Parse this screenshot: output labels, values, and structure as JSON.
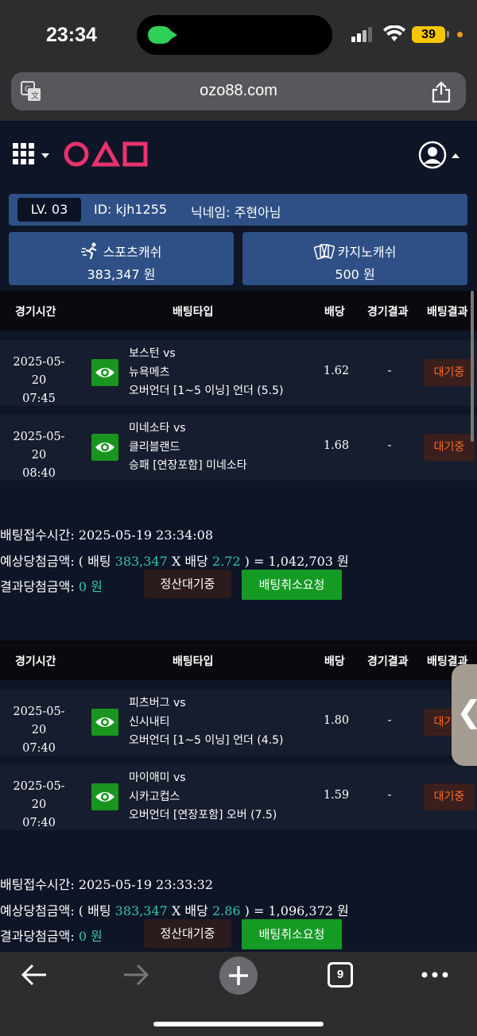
{
  "status_bar": {
    "time": "23:34",
    "battery": "39"
  },
  "browser": {
    "url": "ozo88.com",
    "tab_count": "9"
  },
  "header": {
    "logo": "OΔ□"
  },
  "account": {
    "level": "LV. 03",
    "id": "ID: kjh1255",
    "nickname": "닉네임: 주현아님",
    "sports_cash_label": "스포츠캐쉬",
    "sports_cash_value": "383,347 원",
    "casino_cash_label": "카지노캐쉬",
    "casino_cash_value": "500 원"
  },
  "table_headers": {
    "time": "경기시간",
    "bet_type": "배팅타입",
    "odds": "배당",
    "game_result": "경기결과",
    "bet_result": "배팅결과"
  },
  "bets": [
    {
      "rows": [
        {
          "date": "2025-05-20",
          "time": "07:45",
          "team1": "보스턴 vs",
          "team2": "뉴욕메츠",
          "market": "오버언더 [1~5 이닝] 언더 (5.5)",
          "odds": "1.62",
          "result": "-",
          "status": "대기중"
        },
        {
          "date": "2025-05-20",
          "time": "08:40",
          "team1": "미네소타 vs",
          "team2": "클리블랜드",
          "market": "승패 [연장포함] 미네소타",
          "odds": "1.68",
          "result": "-",
          "status": "대기중"
        }
      ],
      "accept_label": "배팅접수시간:",
      "accept_time": "2025-05-19 23:34:08",
      "expected_label": "예상당첨금액: ( 배팅",
      "stake": "383,347",
      "x_label": "X 배당",
      "total_odds": "2.72",
      "expected_tail": ") = 1,042,703 원",
      "result_label": "결과당첨금액:",
      "result_amount": "0 원",
      "settle_button": "정산대기중",
      "cancel_button": "배팅취소요청"
    },
    {
      "rows": [
        {
          "date": "2025-05-20",
          "time": "07:40",
          "team1": "피츠버그 vs",
          "team2": "신시내티",
          "market": "오버언더 [1~5 이닝] 언더 (4.5)",
          "odds": "1.80",
          "result": "-",
          "status": "대기중"
        },
        {
          "date": "2025-05-20",
          "time": "07:40",
          "team1": "마이애미 vs",
          "team2": "시카고컵스",
          "market": "오버언더 [연장포함] 오버 (7.5)",
          "odds": "1.59",
          "result": "-",
          "status": "대기중"
        }
      ],
      "accept_label": "배팅접수시간:",
      "accept_time": "2025-05-19 23:33:32",
      "expected_label": "예상당첨금액: ( 배팅",
      "stake": "383,347",
      "x_label": "X 배당",
      "total_odds": "2.86",
      "expected_tail": ") = 1,096,372 원",
      "result_label": "결과당첨금액:",
      "result_amount": "0 원",
      "settle_button": "정산대기중",
      "cancel_button": "배팅취소요청"
    }
  ],
  "side_tab": "❮",
  "colors": {
    "accent_teal": "#33c7a5",
    "status_orange": "#ff6a26",
    "button_green": "#159a24",
    "panel_blue": "#2f5086",
    "logo_pink": "#e8336f"
  }
}
